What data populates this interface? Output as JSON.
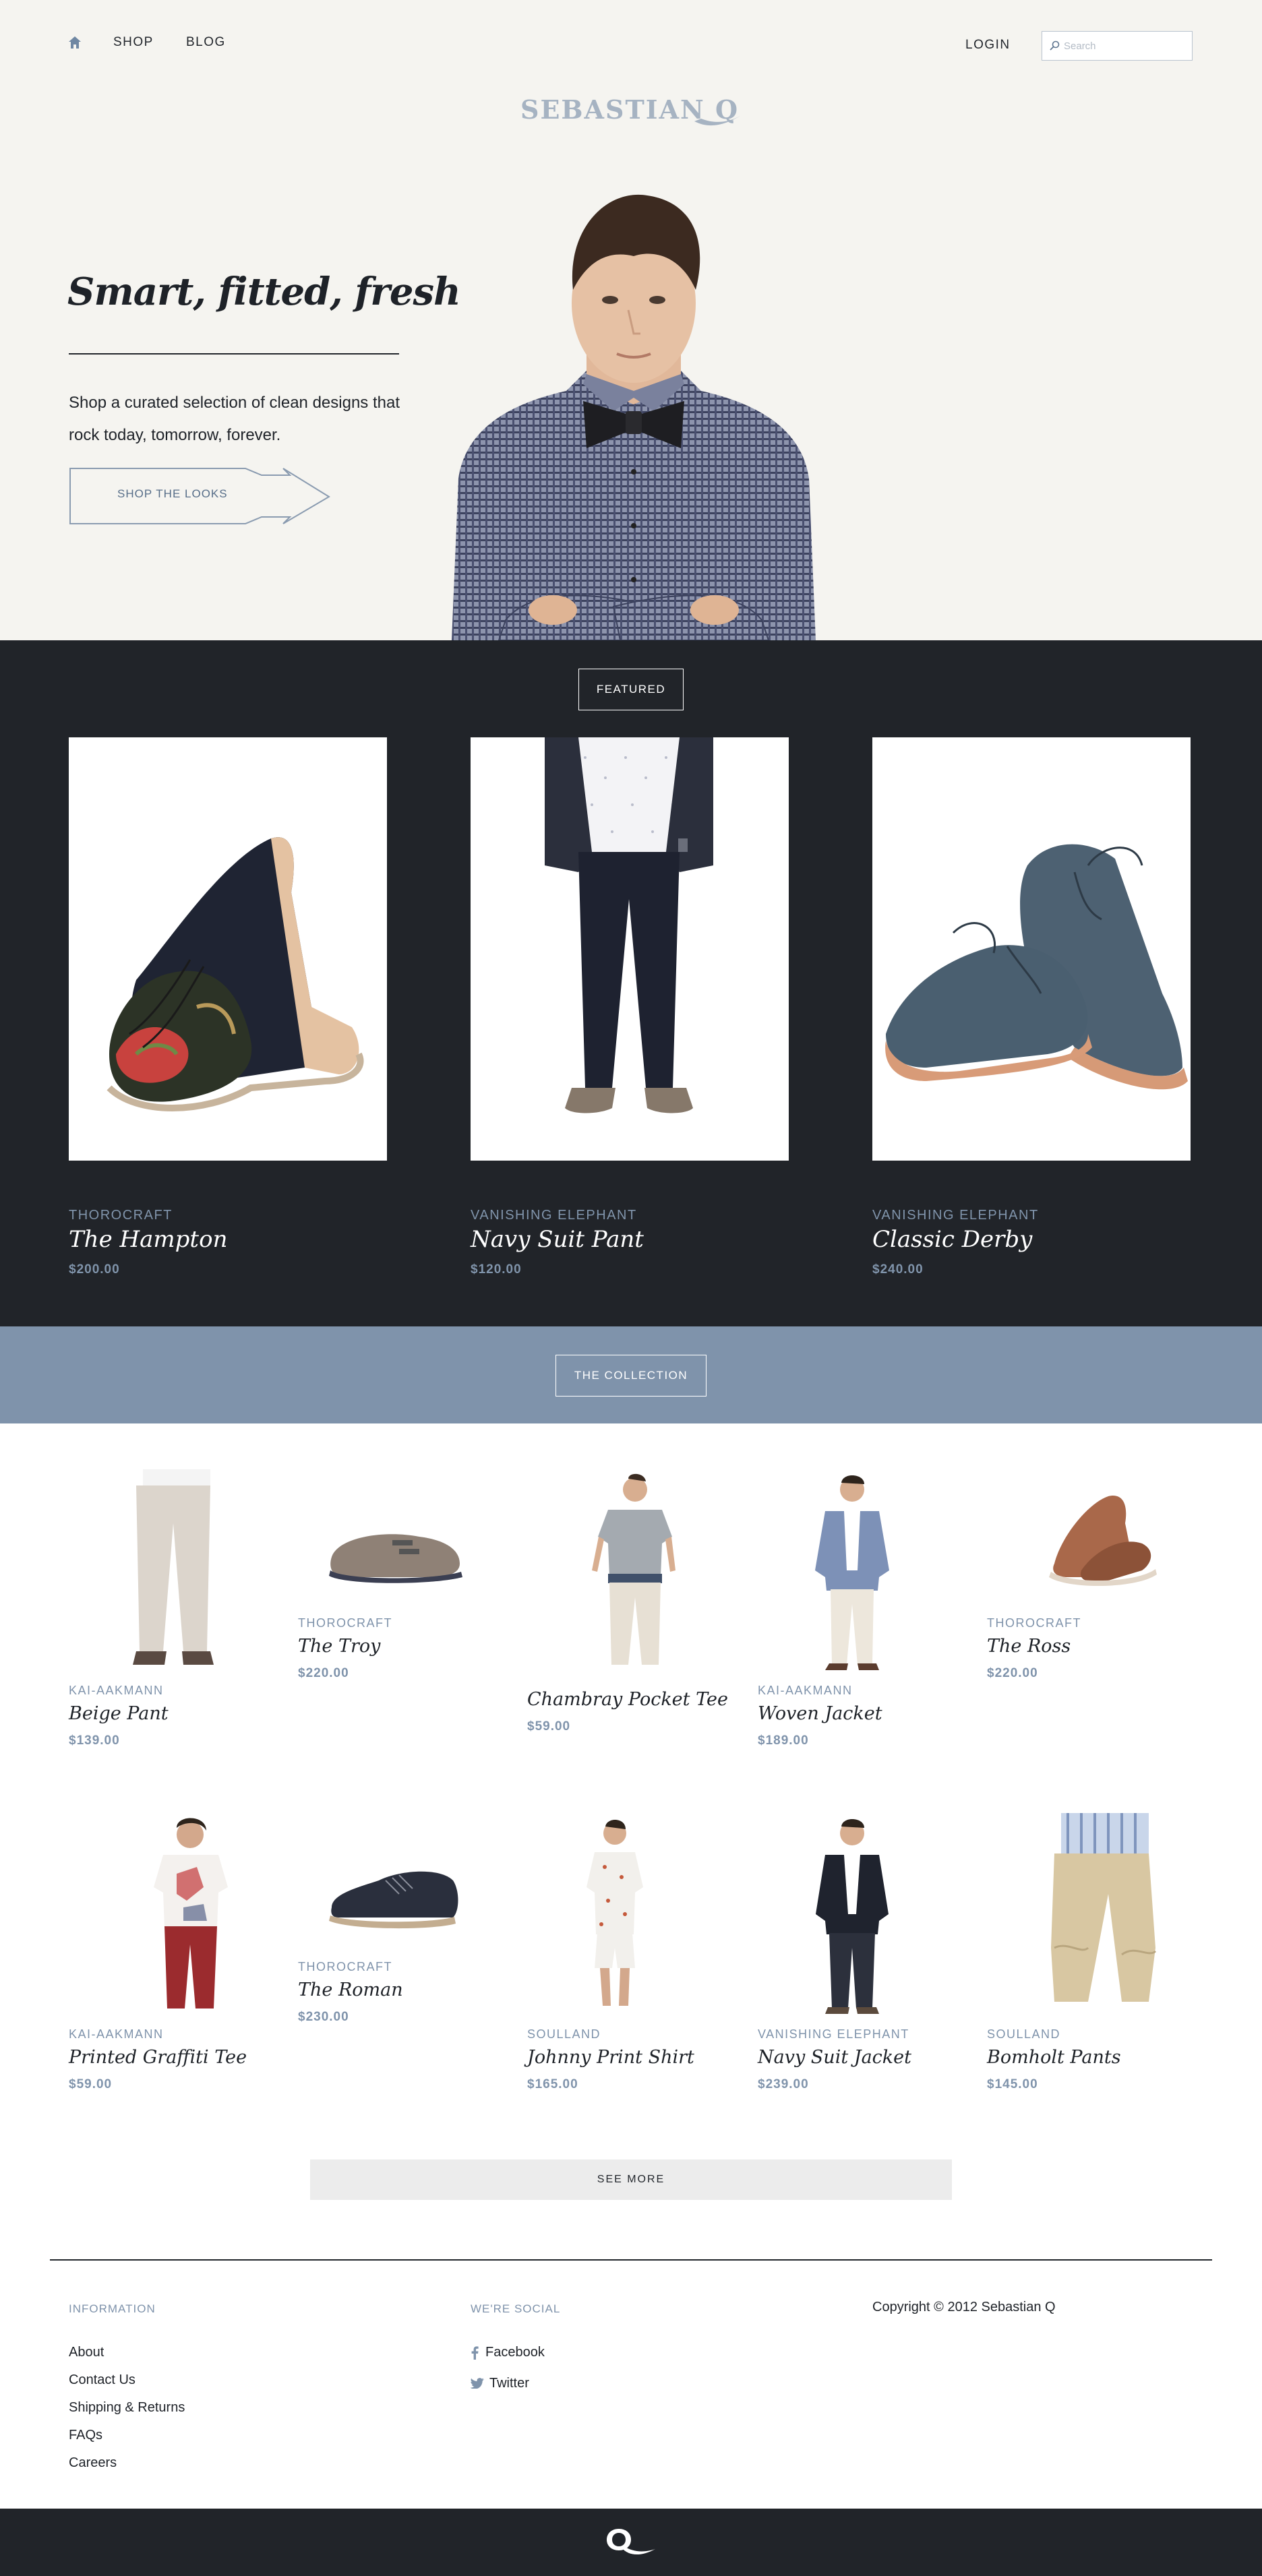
{
  "header": {
    "nav": [
      {
        "label": "SHOP"
      },
      {
        "label": "BLOG"
      }
    ],
    "login_label": "LOGIN",
    "search_placeholder": "Search",
    "logo_text": "SEBASTIAN Q",
    "home_icon": "home-icon"
  },
  "hero": {
    "tagline": "Smart, fitted, fresh",
    "description": "Shop a curated selection of clean designs that rock today, tomorrow, forever.",
    "cta_label": "SHOP THE LOOKS"
  },
  "featured": {
    "heading": "FEATURED",
    "items": [
      {
        "brand": "THOROCRAFT",
        "name": "The Hampton",
        "price": "$200.00"
      },
      {
        "brand": "VANISHING ELEPHANT",
        "name": "Navy Suit Pant",
        "price": "$120.00"
      },
      {
        "brand": "VANISHING ELEPHANT",
        "name": "Classic Derby",
        "price": "$240.00"
      }
    ]
  },
  "collection": {
    "heading": "THE COLLECTION",
    "rows": [
      [
        {
          "brand": "KAI-AAKMANN",
          "name": "Beige Pant",
          "price": "$139.00"
        },
        {
          "brand": "THOROCRAFT",
          "name": "The Troy",
          "price": "$220.00"
        },
        {
          "brand": "",
          "name": "Chambray Pocket Tee",
          "price": "$59.00"
        },
        {
          "brand": "KAI-AAKMANN",
          "name": "Woven Jacket",
          "price": "$189.00"
        },
        {
          "brand": "THOROCRAFT",
          "name": "The Ross",
          "price": "$220.00"
        }
      ],
      [
        {
          "brand": "KAI-AAKMANN",
          "name": "Printed Graffiti Tee",
          "price": "$59.00"
        },
        {
          "brand": "THOROCRAFT",
          "name": "The Roman",
          "price": "$230.00"
        },
        {
          "brand": "SOULLAND",
          "name": "Johnny Print Shirt",
          "price": "$165.00"
        },
        {
          "brand": "VANISHING ELEPHANT",
          "name": "Navy Suit Jacket",
          "price": "$239.00"
        },
        {
          "brand": "SOULLAND",
          "name": "Bomholt Pants",
          "price": "$145.00"
        }
      ]
    ],
    "see_more_label": "SEE MORE"
  },
  "footer": {
    "info_heading": "INFORMATION",
    "info_links": [
      "About",
      "Contact Us",
      "Shipping & Returns",
      "FAQs",
      "Careers"
    ],
    "social_heading": "WE'RE SOCIAL",
    "social_links": [
      {
        "label": "Facebook",
        "icon": "facebook-icon"
      },
      {
        "label": "Twitter",
        "icon": "twitter-icon"
      }
    ],
    "copyright": "Copyright © 2012 Sebastian Q"
  },
  "colors": {
    "accent": "#7f93ab",
    "dark": "#212429",
    "hero_bg": "#f5f4f0"
  }
}
